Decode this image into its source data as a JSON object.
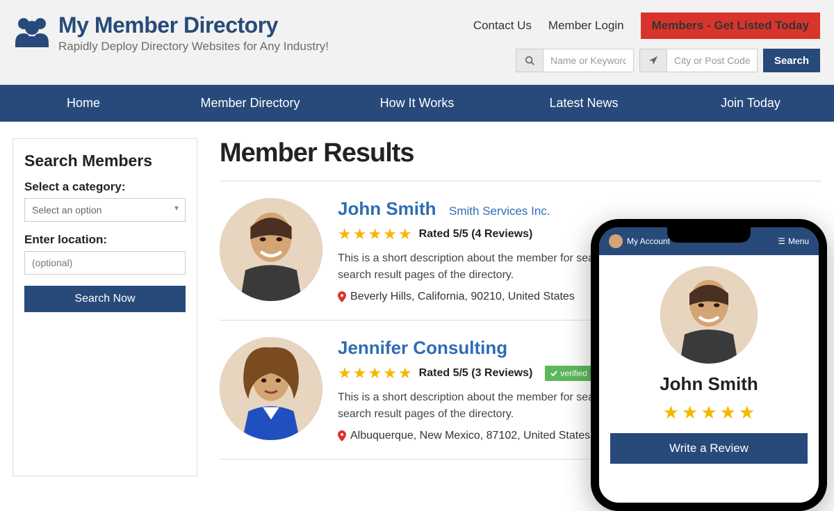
{
  "header": {
    "site_title": "My Member Directory",
    "tagline": "Rapidly Deploy Directory Websites for Any Industry!",
    "links": {
      "contact": "Contact Us",
      "login": "Member Login"
    },
    "cta": "Members - Get Listed Today",
    "search": {
      "name_placeholder": "Name or Keyword",
      "location_placeholder": "City or Post Code",
      "button": "Search"
    }
  },
  "nav": {
    "home": "Home",
    "directory": "Member Directory",
    "how": "How It Works",
    "news": "Latest News",
    "join": "Join Today"
  },
  "sidebar": {
    "title": "Search Members",
    "category_label": "Select a category:",
    "category_placeholder": "Select an option",
    "location_label": "Enter location:",
    "location_placeholder": "(optional)",
    "button": "Search Now"
  },
  "results": {
    "title": "Member Results",
    "members": [
      {
        "name": "John Smith",
        "company": "Smith Services Inc.",
        "rating_text": "Rated 5/5 (4 Reviews)",
        "desc": "This is a short description about the member for search engines, that will only display on the search result pages of the directory.",
        "location": "Beverly Hills, California, 90210, United States",
        "verified": false
      },
      {
        "name": "Jennifer Consulting",
        "company": "",
        "rating_text": "Rated 5/5 (3 Reviews)",
        "desc": "This is a short description about the member for search engines, that will only display on the search result pages of the directory.",
        "location": "Albuquerque, New Mexico, 87102, United States",
        "verified": true,
        "verified_label": "verified"
      }
    ]
  },
  "phone": {
    "account": "My Account",
    "menu": "Menu",
    "name": "John Smith",
    "review_btn": "Write a Review"
  }
}
